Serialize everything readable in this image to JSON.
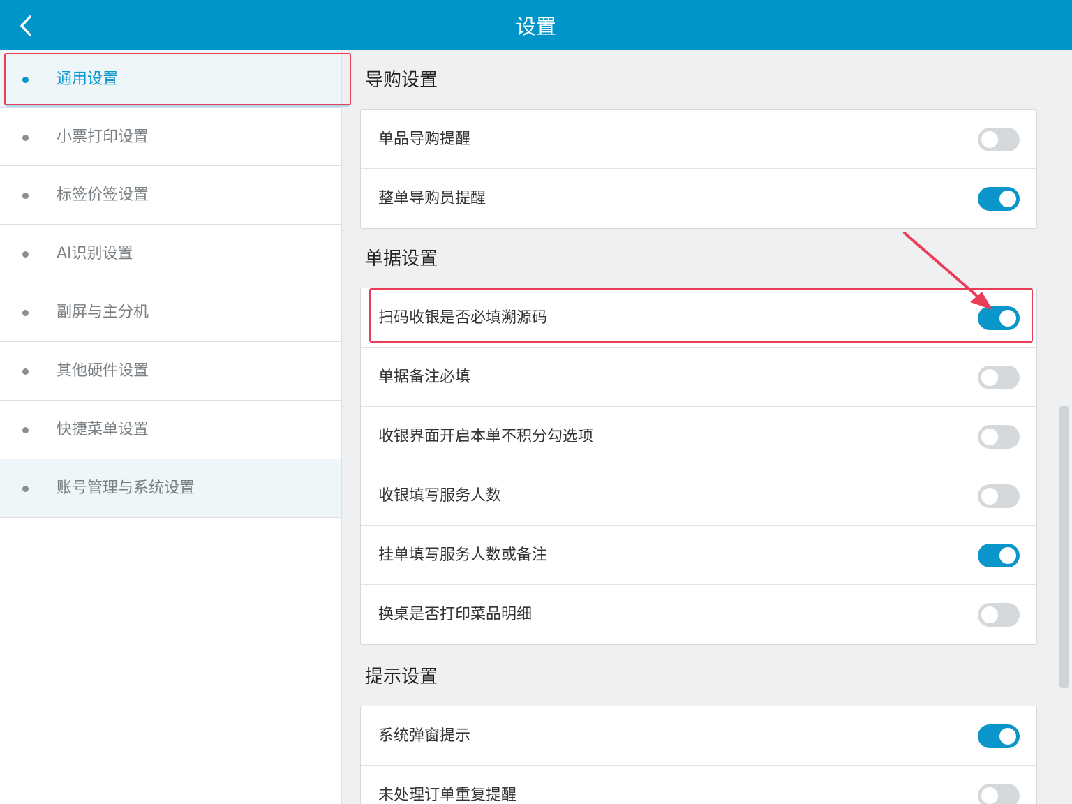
{
  "header": {
    "title": "设置",
    "back_icon": "chevron-left-icon"
  },
  "sidebar": {
    "items": [
      {
        "label": "通用设置",
        "active": true
      },
      {
        "label": "小票打印设置",
        "active": false
      },
      {
        "label": "标签价签设置",
        "active": false
      },
      {
        "label": "AI识别设置",
        "active": false
      },
      {
        "label": "副屏与主分机",
        "active": false
      },
      {
        "label": "其他硬件设置",
        "active": false
      },
      {
        "label": "快捷菜单设置",
        "active": false
      },
      {
        "label": "账号管理与系统设置",
        "active": false
      }
    ]
  },
  "sections": [
    {
      "title": "导购设置",
      "rows": [
        {
          "label": "单品导购提醒",
          "on": false
        },
        {
          "label": "整单导购员提醒",
          "on": true
        }
      ]
    },
    {
      "title": "单据设置",
      "rows": [
        {
          "label": "扫码收银是否必填溯源码",
          "on": true
        },
        {
          "label": "单据备注必填",
          "on": false
        },
        {
          "label": "收银界面开启本单不积分勾选项",
          "on": false
        },
        {
          "label": "收银填写服务人数",
          "on": false
        },
        {
          "label": "挂单填写服务人数或备注",
          "on": true
        },
        {
          "label": "换桌是否打印菜品明细",
          "on": false
        }
      ]
    },
    {
      "title": "提示设置",
      "rows": [
        {
          "label": "系统弹窗提示",
          "on": true
        },
        {
          "label": "未处理订单重复提醒",
          "on": false
        }
      ]
    }
  ],
  "colors": {
    "header": "#0095c9",
    "accent": "#0a95cb",
    "annotation": "#ea3e58",
    "toggle_off": "#d5d9dc"
  }
}
